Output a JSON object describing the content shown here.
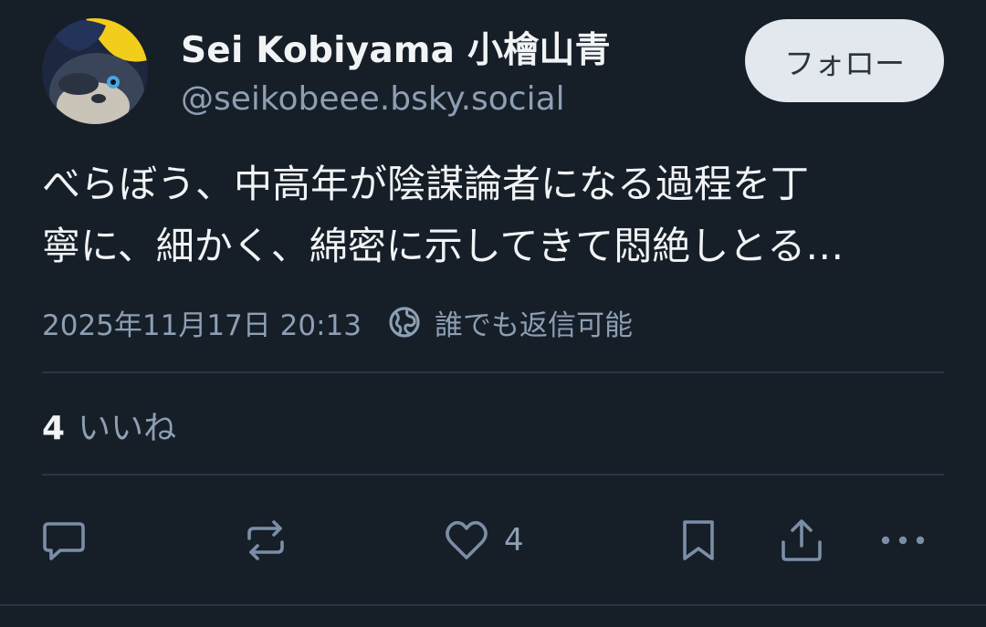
{
  "author": {
    "display_name": "Sei Kobiyama 小檜山青",
    "handle": "@seikobeee.bsky.social",
    "avatar_icon": "cat-avatar"
  },
  "follow_label": "フォロー",
  "post": {
    "text_lines": [
      "べらぼう、中高年が陰謀論者になる過程を丁",
      "寧に、細かく、綿密に示してきて悶絶しとる…"
    ],
    "timestamp": "2025年11月17日 20:13",
    "reply_setting_icon": "globe-icon",
    "reply_setting": "誰でも返信可能"
  },
  "likes": {
    "count": "4",
    "label": "いいね"
  },
  "actions": {
    "reply_icon": "reply-icon",
    "repost_icon": "repost-icon",
    "like_icon": "heart-icon",
    "like_count": "4",
    "bookmark_icon": "bookmark-icon",
    "share_icon": "share-icon",
    "more_icon": "more-icon"
  },
  "colors": {
    "background": "#161e27",
    "text_primary": "#f1f3f5",
    "text_secondary": "#8d9fb4",
    "icon": "#7b8ea6",
    "follow_bg": "#e3e8ee",
    "divider": "#2a3643"
  }
}
